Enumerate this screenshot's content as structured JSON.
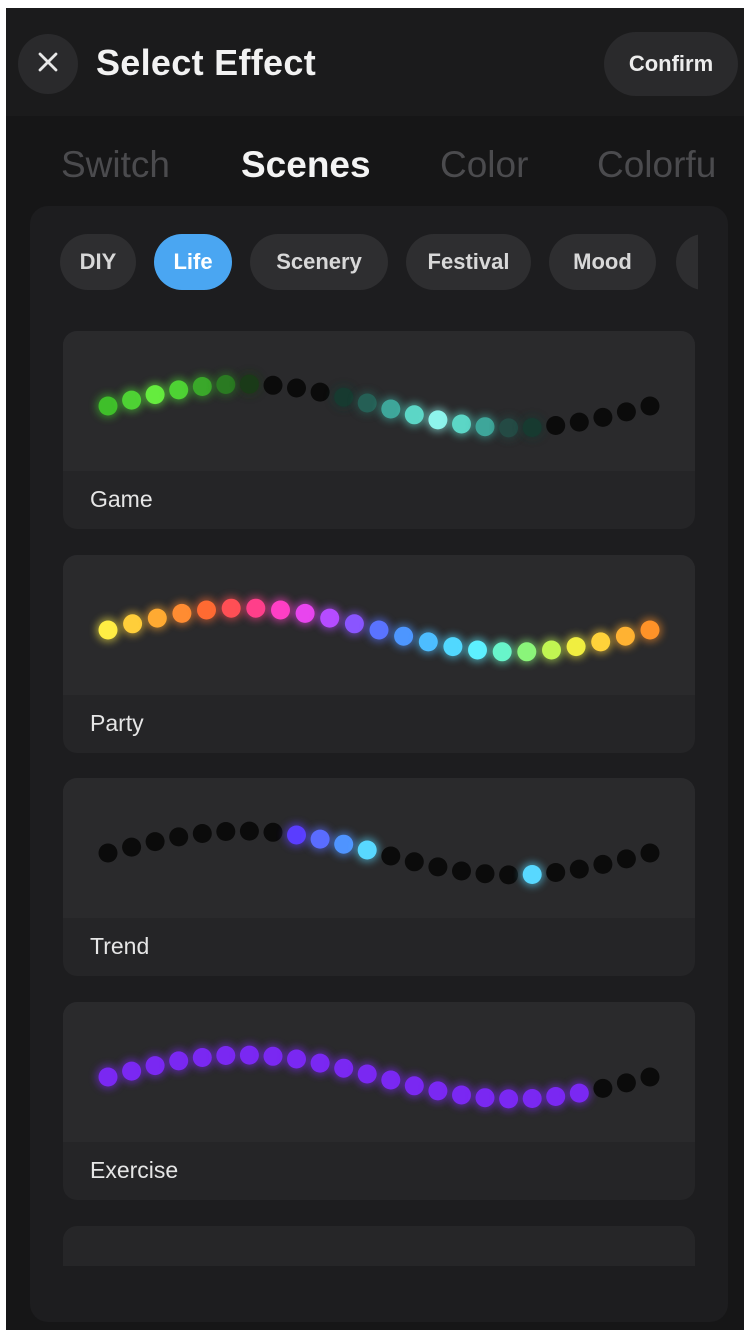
{
  "header": {
    "title": "Select Effect",
    "confirm_label": "Confirm",
    "close_icon": "close-icon"
  },
  "tabs": [
    {
      "label": "Switch",
      "active": false
    },
    {
      "label": "Scenes",
      "active": true
    },
    {
      "label": "Color",
      "active": false
    },
    {
      "label": "Colorfu",
      "active": false
    }
  ],
  "categories": [
    {
      "label": "DIY",
      "active": false
    },
    {
      "label": "Life",
      "active": true
    },
    {
      "label": "Scenery",
      "active": false
    },
    {
      "label": "Festival",
      "active": false
    },
    {
      "label": "Mood",
      "active": false
    },
    {
      "label": "",
      "active": false
    }
  ],
  "colors": {
    "accent": "#4aa6f2",
    "background": "#161617"
  },
  "effects": [
    {
      "label": "Game",
      "dots": [
        "#3fbf2a",
        "#4ed234",
        "#65ec3e",
        "#4ed234",
        "#3aa82a",
        "#2a7a22",
        "#1a3a18",
        "#0b0b0b",
        "#0b0b0b",
        "#0b0b0b",
        "#173a30",
        "#255f55",
        "#3ea69a",
        "#5cd6c6",
        "#8ef4ec",
        "#5cd6c6",
        "#3ea69a",
        "#244a44",
        "#173a30",
        "#0b0b0b",
        "#0b0b0b",
        "#0b0b0b",
        "#0b0b0b",
        "#0b0b0b"
      ]
    },
    {
      "label": "Party",
      "dots": [
        "#ffee44",
        "#ffce3a",
        "#ffaa32",
        "#ff8c32",
        "#ff6a32",
        "#ff4f55",
        "#ff3f8a",
        "#ff3fc4",
        "#e845ee",
        "#b54cff",
        "#8a55ff",
        "#5a73ff",
        "#4d96ff",
        "#4dbdff",
        "#51d8ff",
        "#5df0ff",
        "#68f5ca",
        "#8af57a",
        "#c0f552",
        "#f0ee40",
        "#ffd23a",
        "#ffb232",
        "#ff9228"
      ]
    },
    {
      "label": "Trend",
      "dots": [
        "#0b0b0b",
        "#0b0b0b",
        "#0b0b0b",
        "#0b0b0b",
        "#0b0b0b",
        "#0b0b0b",
        "#0b0b0b",
        "#0b0b0b",
        "#5a3dff",
        "#5a6cff",
        "#4f94ff",
        "#58d8ff",
        "#0b0b0b",
        "#0b0b0b",
        "#0b0b0b",
        "#0b0b0b",
        "#0b0b0b",
        "#0b0b0b",
        "#58d8ff",
        "#0b0b0b",
        "#0b0b0b",
        "#0b0b0b",
        "#0b0b0b",
        "#0b0b0b"
      ]
    },
    {
      "label": "Exercise",
      "dots": [
        "#7a28f2",
        "#7a28f2",
        "#7a28f2",
        "#7a28f2",
        "#7a28f2",
        "#7a28f2",
        "#7a28f2",
        "#7a28f2",
        "#7a28f2",
        "#7a28f2",
        "#7a28f2",
        "#7a28f2",
        "#7a28f2",
        "#7a28f2",
        "#7a28f2",
        "#7a28f2",
        "#7a28f2",
        "#7a28f2",
        "#7a28f2",
        "#7a28f2",
        "#7a28f2",
        "#0b0b0b",
        "#0b0b0b",
        "#0b0b0b"
      ]
    }
  ]
}
